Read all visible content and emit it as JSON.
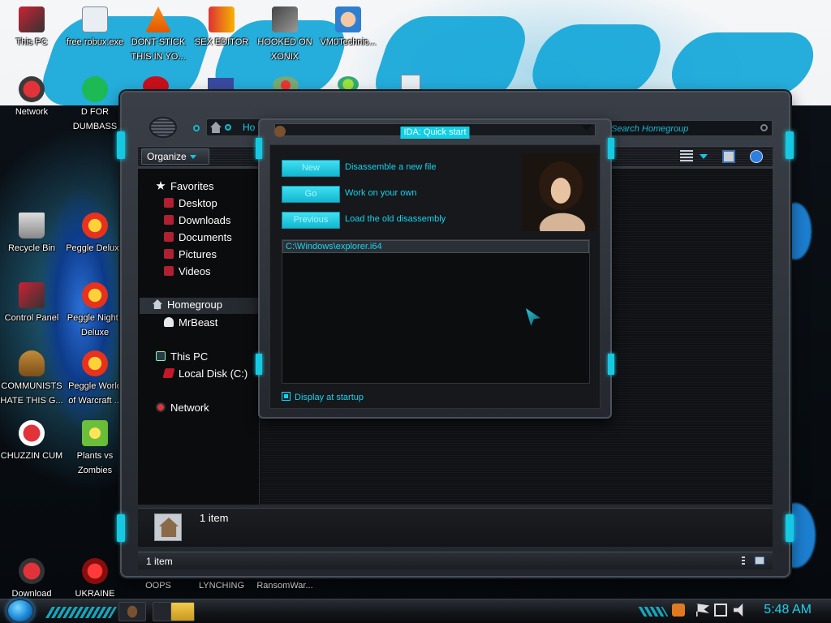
{
  "desktop_icons": [
    {
      "label": "This PC"
    },
    {
      "label": "free robux.exe"
    },
    {
      "label": "DONT STICK THIS IN YO..."
    },
    {
      "label": "SEX EDITOR"
    },
    {
      "label": "HOOKED ON XONIX"
    },
    {
      "label": "VM0Technic..."
    },
    {
      "label": "Network"
    },
    {
      "label": "D FOR DUMBASS"
    },
    {
      "label": "Recycle Bin"
    },
    {
      "label": "Peggle Deluxe"
    },
    {
      "label": "Control Panel"
    },
    {
      "label": "Peggle Nights Deluxe"
    },
    {
      "label": "COMMUNISTS HATE THIS G..."
    },
    {
      "label": "Peggle World of Warcraft ..."
    },
    {
      "label": "CHUZZIN CUM"
    },
    {
      "label": "Plants vs Zombies"
    },
    {
      "label": "Download"
    },
    {
      "label": "UKRAINE"
    },
    {
      "label": "OOPS"
    },
    {
      "label": "LYNCHING"
    },
    {
      "label": "RansomWar..."
    }
  ],
  "explorer": {
    "breadcrumb": "Ho",
    "search_placeholder": "Search Homegroup",
    "toolbar": {
      "organize_label": "Organize"
    },
    "nav": {
      "favorites": "Favorites",
      "desktop": "Desktop",
      "downloads": "Downloads",
      "documents": "Documents",
      "pictures": "Pictures",
      "videos": "Videos",
      "homegroup": "Homegroup",
      "mrbeast": "MrBeast",
      "this_pc": "This PC",
      "local_disk": "Local Disk (C:)",
      "network": "Network"
    },
    "details_text": "1 item",
    "status_text": "1 item"
  },
  "ida": {
    "title": "IDA: Quick start",
    "buttons": [
      {
        "label": "New",
        "desc": "Disassemble a new file"
      },
      {
        "label": "Go",
        "desc": "Work on your own"
      },
      {
        "label": "Previous",
        "desc": "Load the old disassembly"
      }
    ],
    "recent_file": "C:\\Windows\\explorer.i64",
    "display_at_startup": "Display at startup",
    "display_at_startup_checked": true
  },
  "taskbar": {
    "clock": "5:48 AM"
  },
  "colors": {
    "accent": "#18d3ee",
    "window_frame": "#3a3f47",
    "wallpaper_blue": "#19a9d9"
  }
}
